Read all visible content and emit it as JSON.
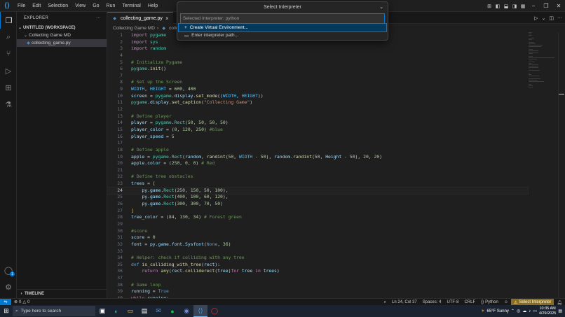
{
  "titlebar": {
    "menu": [
      "File",
      "Edit",
      "Selection",
      "View",
      "Go",
      "Run",
      "Terminal",
      "Help"
    ]
  },
  "activity": {
    "accounts_badge": "1"
  },
  "sidebar": {
    "header": "EXPLORER",
    "workspace": "UNTITLED (WORKSPACE)",
    "folder": "Collecting Game MD",
    "file": "collecting_game.py",
    "timeline": "TIMELINE"
  },
  "editor": {
    "tab_label": "collecting_game.py",
    "breadcrumb_folder": "Collecting Game MD",
    "breadcrumb_file": "colle",
    "current_line": 24
  },
  "quickpick": {
    "title": "Select Interpreter",
    "placeholder": "Selected Interpreter: python",
    "items": [
      "Create Virtual Environment...",
      "Enter interpreter path..."
    ]
  },
  "code_lines": [
    [
      [
        "kw",
        "import"
      ],
      [
        "t",
        " "
      ],
      [
        "mod",
        "pygame"
      ]
    ],
    [
      [
        "kw",
        "import"
      ],
      [
        "t",
        " "
      ],
      [
        "mod",
        "sys"
      ]
    ],
    [
      [
        "kw",
        "import"
      ],
      [
        "t",
        " "
      ],
      [
        "mod",
        "random"
      ]
    ],
    [],
    [
      [
        "cmt",
        "# Initialize Pygame"
      ]
    ],
    [
      [
        "mod",
        "pygame"
      ],
      [
        "t",
        "."
      ],
      [
        "fn",
        "init"
      ],
      [
        "t",
        "()"
      ]
    ],
    [],
    [
      [
        "cmt",
        "# Set up the Screen"
      ]
    ],
    [
      [
        "const",
        "WIDTH"
      ],
      [
        "t",
        ", "
      ],
      [
        "const",
        "HEIGHT"
      ],
      [
        "t",
        " = "
      ],
      [
        "num",
        "600"
      ],
      [
        "t",
        ", "
      ],
      [
        "num",
        "400"
      ]
    ],
    [
      [
        "var",
        "screen"
      ],
      [
        "t",
        " = "
      ],
      [
        "mod",
        "pygame"
      ],
      [
        "t",
        "."
      ],
      [
        "var",
        "display"
      ],
      [
        "t",
        "."
      ],
      [
        "fn",
        "set_mode"
      ],
      [
        "t",
        "(("
      ],
      [
        "const",
        "WIDTH"
      ],
      [
        "t",
        ", "
      ],
      [
        "const",
        "HEIGHT"
      ],
      [
        "t",
        "))"
      ]
    ],
    [
      [
        "mod",
        "pygame"
      ],
      [
        "t",
        "."
      ],
      [
        "var",
        "display"
      ],
      [
        "t",
        "."
      ],
      [
        "fn",
        "set_caption"
      ],
      [
        "t",
        "("
      ],
      [
        "str",
        "\"Collecting Game\""
      ],
      [
        "t",
        ")"
      ]
    ],
    [],
    [
      [
        "cmt",
        "# Define player"
      ]
    ],
    [
      [
        "var",
        "player"
      ],
      [
        "t",
        " = "
      ],
      [
        "mod",
        "pygame"
      ],
      [
        "t",
        "."
      ],
      [
        "mod",
        "Rect"
      ],
      [
        "t",
        "("
      ],
      [
        "num",
        "50"
      ],
      [
        "t",
        ", "
      ],
      [
        "num",
        "50"
      ],
      [
        "t",
        ", "
      ],
      [
        "num",
        "50"
      ],
      [
        "t",
        ", "
      ],
      [
        "num",
        "50"
      ],
      [
        "t",
        ")"
      ]
    ],
    [
      [
        "var",
        "player_color"
      ],
      [
        "t",
        " = ("
      ],
      [
        "num",
        "0"
      ],
      [
        "t",
        ", "
      ],
      [
        "num",
        "120"
      ],
      [
        "t",
        ", "
      ],
      [
        "num",
        "250"
      ],
      [
        "t",
        ") "
      ],
      [
        "cmt",
        "#blue"
      ]
    ],
    [
      [
        "var",
        "player_speed"
      ],
      [
        "t",
        " = "
      ],
      [
        "num",
        "5"
      ]
    ],
    [],
    [
      [
        "cmt",
        "# Define apple"
      ]
    ],
    [
      [
        "var",
        "apple"
      ],
      [
        "t",
        " = "
      ],
      [
        "mod",
        "pygame"
      ],
      [
        "t",
        "."
      ],
      [
        "mod",
        "Rect"
      ],
      [
        "t",
        "("
      ],
      [
        "var",
        "random"
      ],
      [
        "t",
        ", "
      ],
      [
        "fn",
        "randint"
      ],
      [
        "t",
        "("
      ],
      [
        "num",
        "50"
      ],
      [
        "t",
        ", "
      ],
      [
        "const",
        "WIDTH"
      ],
      [
        "t",
        " - "
      ],
      [
        "num",
        "50"
      ],
      [
        "t",
        "), "
      ],
      [
        "var",
        "random"
      ],
      [
        "t",
        "."
      ],
      [
        "fn",
        "randint"
      ],
      [
        "t",
        "("
      ],
      [
        "num",
        "50"
      ],
      [
        "t",
        ", "
      ],
      [
        "var",
        "Height"
      ],
      [
        "t",
        " - "
      ],
      [
        "num",
        "50"
      ],
      [
        "t",
        "), "
      ],
      [
        "num",
        "20"
      ],
      [
        "t",
        ", "
      ],
      [
        "num",
        "20"
      ],
      [
        "t",
        ")"
      ]
    ],
    [
      [
        "var",
        "apple"
      ],
      [
        "t",
        "."
      ],
      [
        "var",
        "color"
      ],
      [
        "t",
        " = ("
      ],
      [
        "num",
        "250"
      ],
      [
        "t",
        ", "
      ],
      [
        "num",
        "0"
      ],
      [
        "t",
        ", "
      ],
      [
        "num",
        "0"
      ],
      [
        "t",
        ") "
      ],
      [
        "cmt",
        "# Red"
      ]
    ],
    [],
    [
      [
        "cmt",
        "# Define tree obstacles"
      ]
    ],
    [
      [
        "var",
        "trees"
      ],
      [
        "t",
        " = "
      ],
      [
        "br",
        "["
      ]
    ],
    [
      [
        "t",
        "    "
      ],
      [
        "var",
        "py"
      ],
      [
        "t",
        "."
      ],
      [
        "var",
        "game"
      ],
      [
        "t",
        "."
      ],
      [
        "mod",
        "Rect"
      ],
      [
        "t",
        "("
      ],
      [
        "num",
        "250"
      ],
      [
        "t",
        ", "
      ],
      [
        "num",
        "150"
      ],
      [
        "t",
        ", "
      ],
      [
        "num",
        "50"
      ],
      [
        "t",
        ", "
      ],
      [
        "num",
        "100"
      ],
      [
        "t",
        "),"
      ]
    ],
    [
      [
        "t",
        "    "
      ],
      [
        "var",
        "py"
      ],
      [
        "t",
        "."
      ],
      [
        "var",
        "game"
      ],
      [
        "t",
        "."
      ],
      [
        "mod",
        "Rect"
      ],
      [
        "t",
        "("
      ],
      [
        "num",
        "400"
      ],
      [
        "t",
        ", "
      ],
      [
        "num",
        "100"
      ],
      [
        "t",
        ", "
      ],
      [
        "num",
        "60"
      ],
      [
        "t",
        ", "
      ],
      [
        "num",
        "120"
      ],
      [
        "t",
        "),"
      ]
    ],
    [
      [
        "t",
        "    "
      ],
      [
        "var",
        "py"
      ],
      [
        "t",
        "."
      ],
      [
        "var",
        "game"
      ],
      [
        "t",
        "."
      ],
      [
        "mod",
        "Rect"
      ],
      [
        "t",
        "("
      ],
      [
        "num",
        "300"
      ],
      [
        "t",
        ", "
      ],
      [
        "num",
        "300"
      ],
      [
        "t",
        ", "
      ],
      [
        "num",
        "70"
      ],
      [
        "t",
        ", "
      ],
      [
        "num",
        "50"
      ],
      [
        "t",
        ")"
      ]
    ],
    [
      [
        "br",
        "]"
      ]
    ],
    [
      [
        "var",
        "tree_color"
      ],
      [
        "t",
        " = ("
      ],
      [
        "num",
        "84"
      ],
      [
        "t",
        ", "
      ],
      [
        "num",
        "130"
      ],
      [
        "t",
        ", "
      ],
      [
        "num",
        "34"
      ],
      [
        "t",
        ") "
      ],
      [
        "cmt",
        "# Forest green"
      ]
    ],
    [],
    [
      [
        "cmt",
        "#score"
      ]
    ],
    [
      [
        "var",
        "score"
      ],
      [
        "t",
        " = "
      ],
      [
        "num",
        "0"
      ]
    ],
    [
      [
        "var",
        "font"
      ],
      [
        "t",
        " = "
      ],
      [
        "var",
        "py"
      ],
      [
        "t",
        "."
      ],
      [
        "var",
        "game"
      ],
      [
        "t",
        "."
      ],
      [
        "var",
        "font"
      ],
      [
        "t",
        "."
      ],
      [
        "var",
        "Sysfont"
      ],
      [
        "t",
        "("
      ],
      [
        "kw2",
        "None"
      ],
      [
        "t",
        ", "
      ],
      [
        "num",
        "36"
      ],
      [
        "t",
        ")"
      ]
    ],
    [],
    [
      [
        "cmt",
        "# Helper: check if colliding with any tree"
      ]
    ],
    [
      [
        "kw2",
        "def"
      ],
      [
        "t",
        " "
      ],
      [
        "fn",
        "is_colliding_with_tree"
      ],
      [
        "t",
        "("
      ],
      [
        "var",
        "rect"
      ],
      [
        "t",
        "):"
      ]
    ],
    [
      [
        "t",
        "    "
      ],
      [
        "kw",
        "return"
      ],
      [
        "t",
        " "
      ],
      [
        "fn",
        "any"
      ],
      [
        "t",
        "("
      ],
      [
        "var",
        "rect"
      ],
      [
        "t",
        "."
      ],
      [
        "fn",
        "colliderect"
      ],
      [
        "t",
        "("
      ],
      [
        "var",
        "tree"
      ],
      [
        "t",
        ")"
      ],
      [
        "kw",
        "for"
      ],
      [
        "t",
        " "
      ],
      [
        "var",
        "tree"
      ],
      [
        "t",
        " "
      ],
      [
        "kw",
        "in"
      ],
      [
        "t",
        " "
      ],
      [
        "var",
        "trees"
      ],
      [
        "t",
        ")"
      ]
    ],
    [],
    [
      [
        "cmt",
        "# Game loop"
      ]
    ],
    [
      [
        "var",
        "running"
      ],
      [
        "t",
        " = "
      ],
      [
        "kw2",
        "True"
      ]
    ],
    [
      [
        "kw",
        "while"
      ],
      [
        "t",
        " "
      ],
      [
        "var",
        "running"
      ],
      [
        "t",
        ":"
      ]
    ]
  ],
  "statusbar": {
    "errors": "0",
    "warnings": "0",
    "position": "Ln 24, Col 37",
    "spaces": "Spaces: 4",
    "encoding": "UTF-8",
    "eol": "CRLF",
    "language": "Python",
    "interpreter": "Select Interpreter"
  },
  "taskbar": {
    "search_placeholder": "Type here to search",
    "weather": "65°F  Sunny",
    "time": "10:35 AM",
    "date": "4/29/2025"
  },
  "colors": {
    "accent": "#0078d4",
    "warning_bg": "#8a6d1e"
  }
}
